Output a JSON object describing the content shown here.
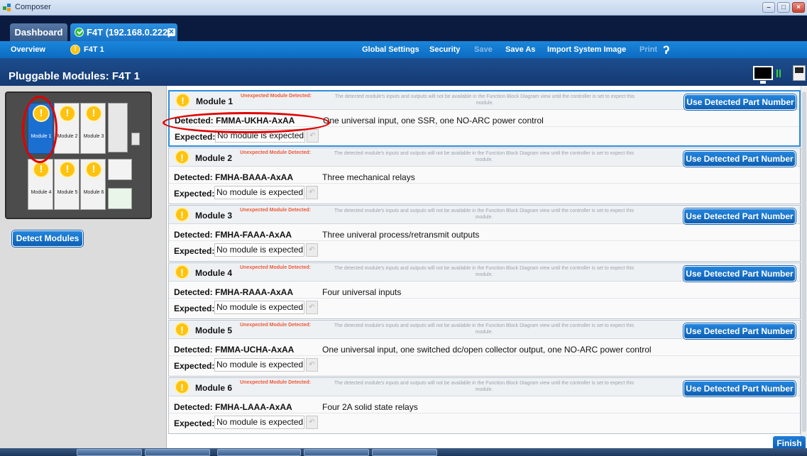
{
  "window": {
    "title": "Composer"
  },
  "tabs": {
    "dashboard": "Dashboard",
    "device": "F4T (192.168.0.222)"
  },
  "menu": {
    "overview": "Overview",
    "device": "F4T 1",
    "global_settings": "Global Settings",
    "security": "Security",
    "save": "Save",
    "save_as": "Save As",
    "import": "Import System Image",
    "print": "Print"
  },
  "header": {
    "title": "Pluggable Modules: F4T 1"
  },
  "device_panel": {
    "slots": [
      "Module 1",
      "Module 2",
      "Module 3",
      "Module 4",
      "Module 5",
      "Module 6"
    ],
    "detect_button": "Detect Modules"
  },
  "warning": {
    "label": "Unexpected Module Detected:",
    "text": "The detected module's inputs and outputs will not be available in the Function Block Diagram view until the controller is set to expect this module."
  },
  "labels": {
    "use_button": "Use Detected Part Number",
    "detected": "Detected:",
    "expected": "Expected:"
  },
  "modules": [
    {
      "name": "Module 1",
      "part": "FMMA-UKHA-AxAA",
      "description": "One universal input, one SSR, one NO-ARC power control",
      "expected": "No module is expected"
    },
    {
      "name": "Module 2",
      "part": "FMHA-BAAA-AxAA",
      "description": "Three mechanical relays",
      "expected": "No module is expected"
    },
    {
      "name": "Module 3",
      "part": "FMHA-FAAA-AxAA",
      "description": "Three univeral process/retransmit outputs",
      "expected": "No module is expected"
    },
    {
      "name": "Module 4",
      "part": "FMHA-RAAA-AxAA",
      "description": "Four universal inputs",
      "expected": "No module is expected"
    },
    {
      "name": "Module 5",
      "part": "FMMA-UCHA-AxAA",
      "description": "One universal input, one switched dc/open collector output, one NO-ARC power control",
      "expected": "No module is expected"
    },
    {
      "name": "Module 6",
      "part": "FMHA-LAAA-AxAA",
      "description": "Four 2A solid state relays",
      "expected": "No module is expected"
    }
  ],
  "footer": {
    "finish": "Finish"
  },
  "colors": {
    "accent": "#1a86db",
    "warning": "#ffc20e",
    "highlight_ring": "#e00000"
  }
}
